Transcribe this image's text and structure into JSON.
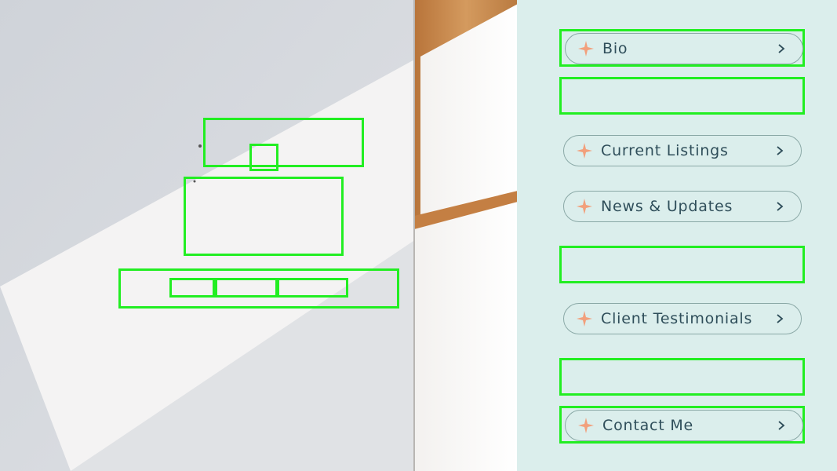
{
  "scene": {
    "wall_color": "#eeedee",
    "shadow_color": "#d7dadf",
    "wood_color": "#c9884e",
    "highlight_color": "#22ee22"
  },
  "menu": {
    "panel_color": "#dbeeec",
    "accent_color": "#f2a07c",
    "text_color": "#2f4e5a",
    "sparkle_icon": "four-point-star-icon",
    "chevron_icon": "chevron-right-icon",
    "items": [
      {
        "label": "Bio",
        "chevron": "›"
      },
      {
        "label": "Current Listings",
        "chevron": "›"
      },
      {
        "label": "News & Updates",
        "chevron": "›"
      },
      {
        "label": "Client Testimonials",
        "chevron": "›"
      },
      {
        "label": "Contact Me",
        "chevron": "›"
      }
    ]
  }
}
